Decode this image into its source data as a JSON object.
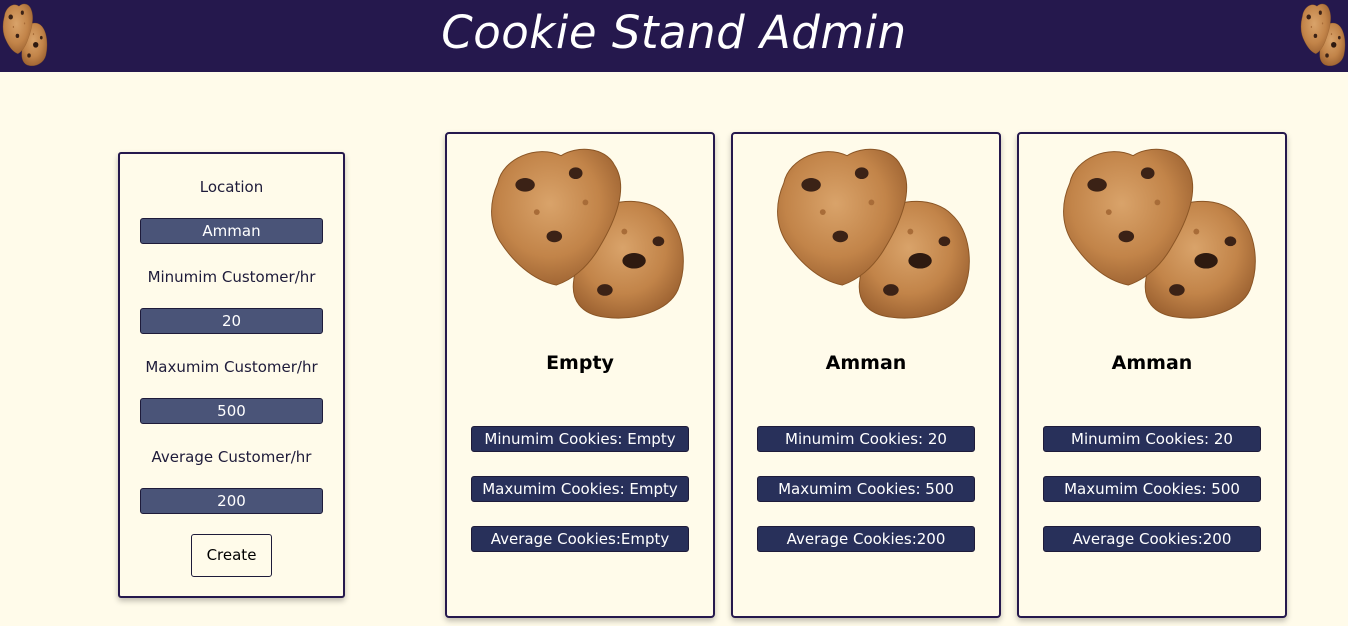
{
  "header": {
    "title": "Cookie Stand Admin",
    "logo_icon": "cookie-icon"
  },
  "form": {
    "location_label": "Location",
    "location_value": "Amman",
    "min_label": "Minumim Customer/hr",
    "min_value": "20",
    "max_label": "Maxumim Customer/hr",
    "max_value": "500",
    "avg_label": "Average Customer/hr",
    "avg_value": "200",
    "create_label": "Create"
  },
  "cards": [
    {
      "title": "Empty",
      "min": "Minumim Cookies: Empty",
      "max": "Maxumim Cookies: Empty",
      "avg": "Average Cookies:Empty"
    },
    {
      "title": "Amman",
      "min": "Minumim Cookies: 20",
      "max": "Maxumim Cookies: 500",
      "avg": "Average Cookies:200"
    },
    {
      "title": "Amman",
      "min": "Minumim Cookies: 20",
      "max": "Maxumim Cookies: 500",
      "avg": "Average Cookies:200"
    }
  ],
  "colors": {
    "header_bg": "#25184d",
    "page_bg": "#fffbea",
    "input_bg": "#4a5478",
    "stat_bg": "#28305a"
  }
}
